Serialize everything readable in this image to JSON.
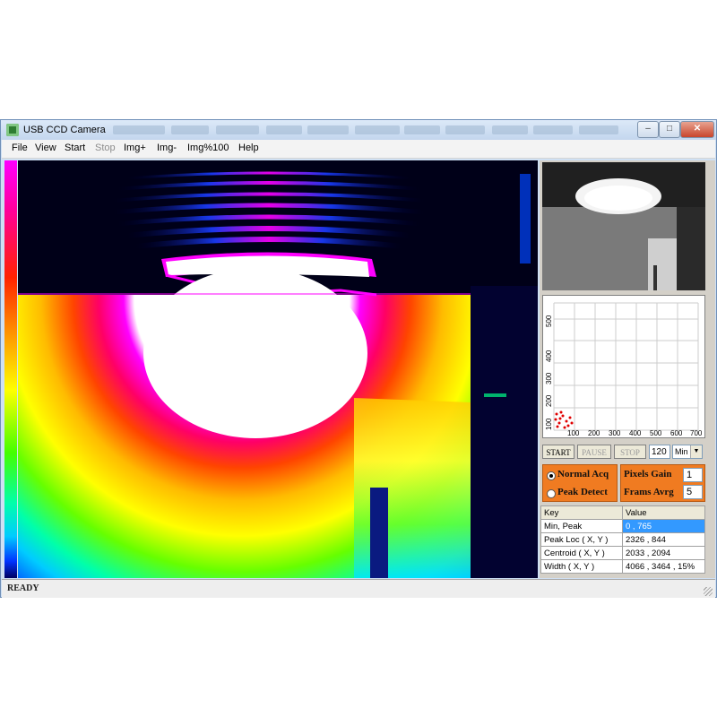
{
  "window": {
    "title": "USB CCD Camera"
  },
  "menu": [
    {
      "label": "File",
      "enabled": true
    },
    {
      "label": "View",
      "enabled": true
    },
    {
      "label": "Start",
      "enabled": true
    },
    {
      "label": "Stop",
      "enabled": false
    },
    {
      "label": "Img+",
      "enabled": true
    },
    {
      "label": "Img-",
      "enabled": true
    },
    {
      "label": "Img%100",
      "enabled": true
    },
    {
      "label": "Help",
      "enabled": true
    }
  ],
  "plot": {
    "y_ticks": [
      "100",
      "200",
      "300",
      "400",
      "500"
    ],
    "x_ticks": [
      "100",
      "200",
      "300",
      "400",
      "500",
      "600",
      "700"
    ]
  },
  "controls": {
    "start_label": "START",
    "pause_label": "PAUSE",
    "stop_label": "STOP",
    "interval_value": "120",
    "unit_value": "Min"
  },
  "modes": {
    "normal_label": "Normal Acq",
    "peak_label": "Peak Detect",
    "selected": "normal"
  },
  "settings": {
    "gain_label": "Pixels Gain",
    "gain_value": "1",
    "avg_label": "Frams Avrg",
    "avg_value": "5"
  },
  "results": {
    "header_key": "Key",
    "header_value": "Value",
    "rows": [
      {
        "key": "Min, Peak",
        "value": "0 , 765"
      },
      {
        "key": "Peak Loc ( X, Y )",
        "value": "2326 , 844"
      },
      {
        "key": "Centroid ( X, Y )",
        "value": "2033 , 2094"
      },
      {
        "key": "Width ( X, Y )",
        "value": "4066 , 3464 , 15%"
      }
    ]
  },
  "status": {
    "text": "READY"
  },
  "icons": {
    "app": "camera-app-icon",
    "minimize": "minimize-icon",
    "maximize": "maximize-icon",
    "close": "close-icon",
    "dropdown": "chevron-down-icon"
  }
}
